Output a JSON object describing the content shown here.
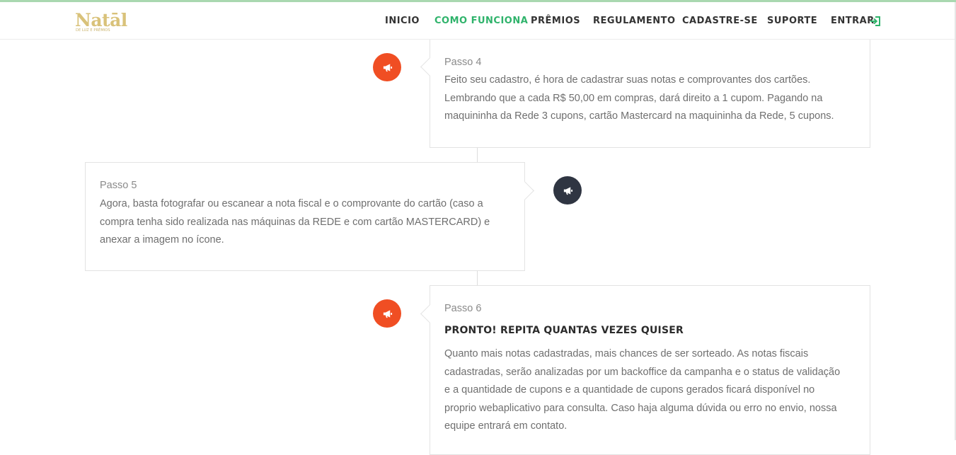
{
  "brand": {
    "logo_text": "Natāl",
    "logo_subtext": "DE LUZ E PRÊMIOS",
    "colors": {
      "logo_gold": "#d9c27a",
      "accent_green": "#2fb36b",
      "badge_red": "#f04e23",
      "badge_dark": "#2f3542",
      "top_strip": "#a9d8b0"
    }
  },
  "nav": {
    "items": [
      {
        "label": "INICIO",
        "active": false
      },
      {
        "label": "COMO FUNCIONA",
        "active": true
      },
      {
        "label": "PRÊMIOS",
        "active": false
      },
      {
        "label": "REGULAMENTO",
        "active": false
      },
      {
        "label": "CADASTRE-SE",
        "active": false
      },
      {
        "label": "SUPORTE",
        "active": false
      },
      {
        "label": "ENTRAR",
        "active": false,
        "icon": "sign-in-icon"
      }
    ]
  },
  "timeline": {
    "steps": [
      {
        "label": "Passo 4",
        "badge_icon": "megaphone-icon",
        "badge_color": "#f04e23",
        "text_lines": [
          "Feito seu cadastro, é hora de cadastrar suas notas e comprovantes dos cartões.",
          "Lembrando que a cada R$ 50,00 em compras, dará direito a 1 cupom. Pagando na",
          "maquininha da Rede 3 cupons, cartão Mastercard na maquininha da Rede, 5 cupons."
        ]
      },
      {
        "label": "Passo 5",
        "badge_icon": "megaphone-icon",
        "badge_color": "#2f3542",
        "text_lines": [
          "Agora, basta fotografar ou escanear a nota fiscal e o comprovante do cartão (caso a",
          "compra tenha sido realizada nas máquinas da REDE e com cartão MASTERCARD) e",
          "anexar a imagem no ícone."
        ]
      },
      {
        "label": "Passo 6",
        "badge_icon": "megaphone-icon",
        "badge_color": "#f04e23",
        "heading": "PRONTO! REPITA QUANTAS VEZES QUISER",
        "text_lines": [
          "Quanto mais notas cadastradas, mais chances de ser sorteado. As notas fiscais",
          "cadastradas, serão analizadas por um backoffice da campanha e o status de validação",
          "e a quantidade de cupons e a quantidade de cupons gerados ficará disponível no",
          "proprio webaplicativo para consulta. Caso haja alguma dúvida ou erro no envio, nossa",
          "equipe entrará em contato."
        ]
      }
    ]
  }
}
